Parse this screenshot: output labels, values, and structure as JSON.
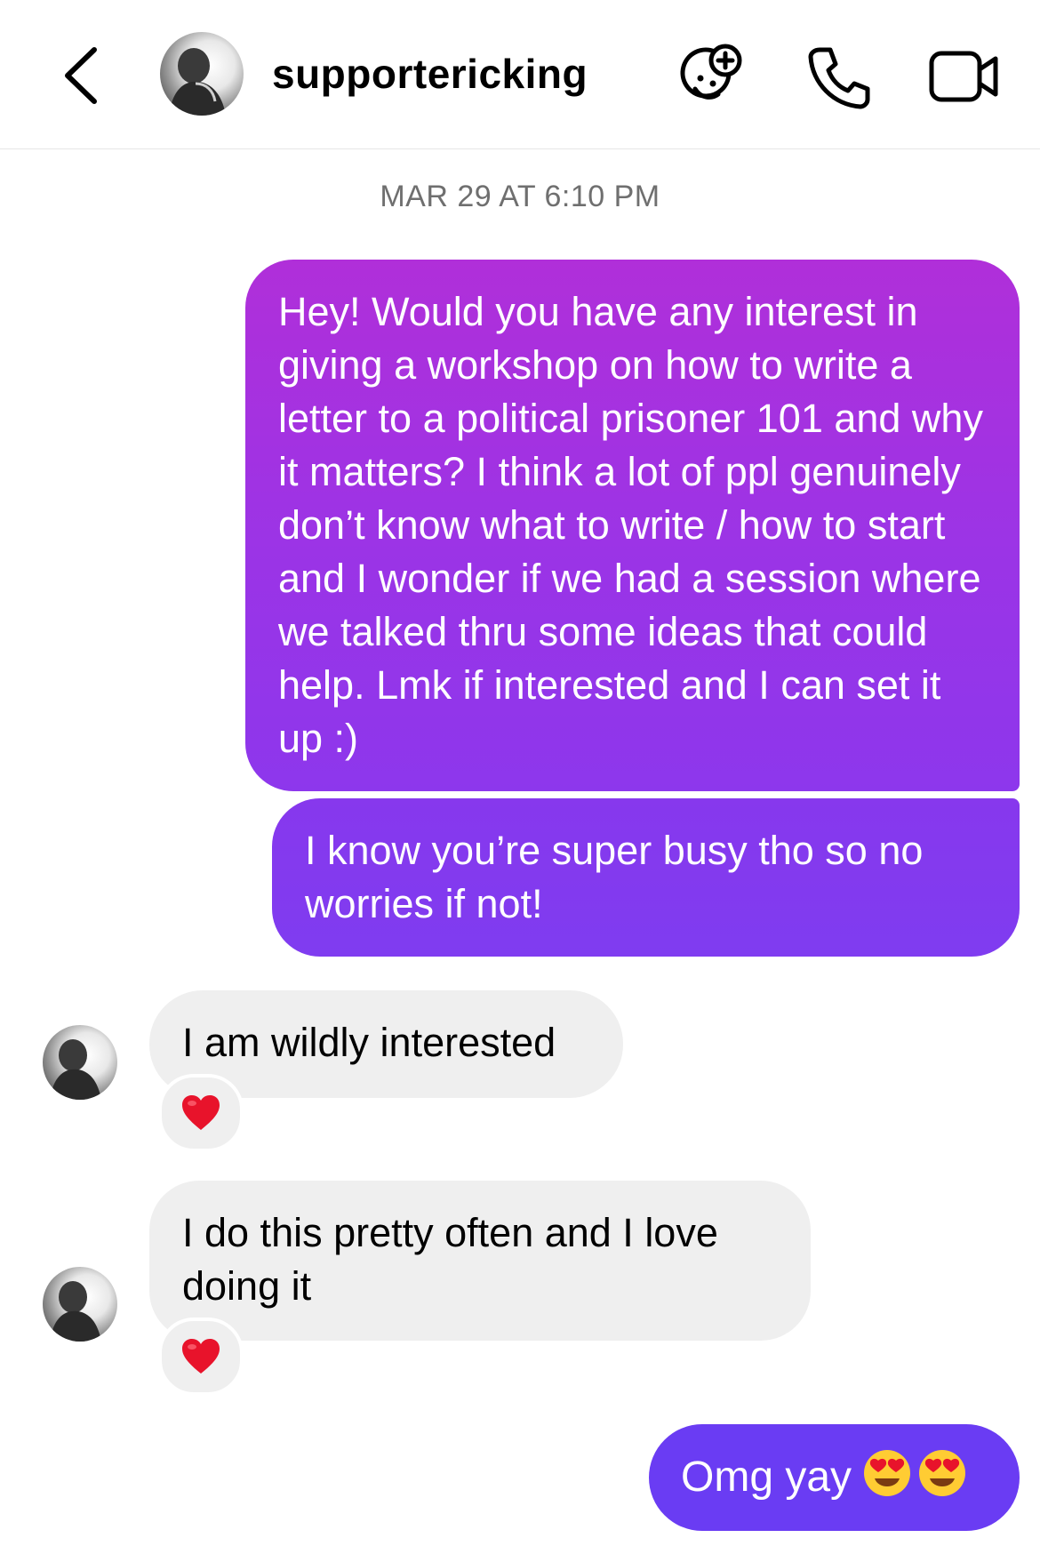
{
  "header": {
    "username": "supportericking",
    "icons": [
      "back-arrow-icon",
      "add-friend-face-icon",
      "phone-icon",
      "video-camera-icon"
    ]
  },
  "conversation": {
    "timestamp": "MAR 29 AT 6:10 PM",
    "messages": [
      {
        "direction": "outgoing",
        "text": "Hey! Would you have any interest in giving a workshop on how to write a letter to a political prisoner 101 and why it matters? I think a lot of ppl genuinely don’t know what to write / how to start and I wonder if we had a session where we talked thru some ideas that could help. Lmk if interested and I can set it up :)"
      },
      {
        "direction": "outgoing",
        "text": "I know you’re super busy tho so no worries if not!"
      },
      {
        "direction": "incoming",
        "text": "I am wildly interested",
        "reaction": "heart-icon"
      },
      {
        "direction": "incoming",
        "text": "I do this pretty often and I love doing it",
        "reaction": "heart-icon"
      },
      {
        "direction": "outgoing",
        "text": "Omg yay",
        "emojis": [
          "heart-eyes-emoji-icon",
          "heart-eyes-emoji-icon"
        ]
      }
    ]
  },
  "colors": {
    "outgoing_top": "#b02fd9",
    "outgoing_bottom": "#6a3cf3",
    "incoming_bubble": "#efefef",
    "timestamp_text": "#6f6f6f",
    "heart": "#e8132b"
  }
}
